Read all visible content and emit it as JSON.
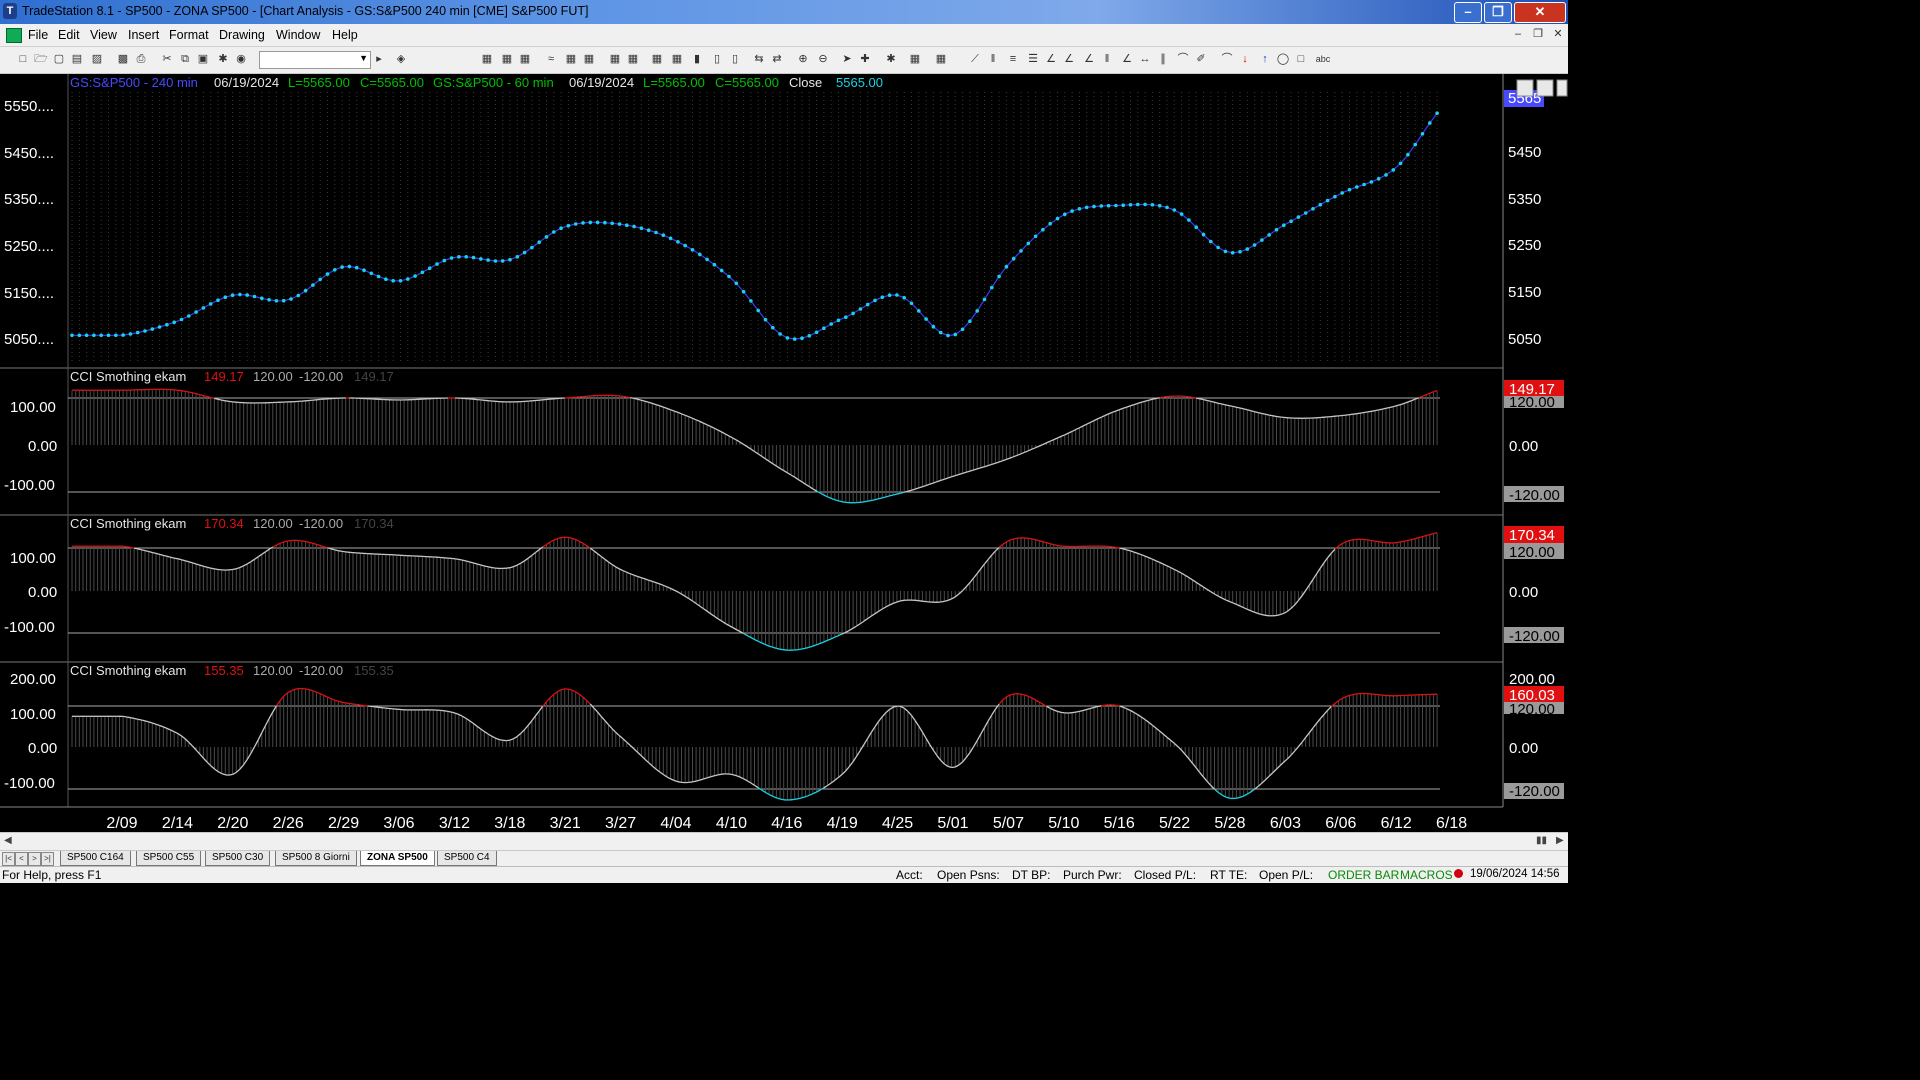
{
  "window": {
    "title": "TradeStation 8.1 - SP500 - ZONA SP500 - [Chart Analysis - GS:S&P500  240 min  [CME] S&P500 FUT]",
    "controls": [
      "minimize-icon",
      "restore-icon",
      "close-icon"
    ]
  },
  "menu": [
    "File",
    "Edit",
    "View",
    "Insert",
    "Format",
    "Drawing",
    "Window",
    "Help"
  ],
  "toolbar": {
    "symbol_combo_value": ""
  },
  "price_header": {
    "symbol1": "GS:S&P500 - 240 min",
    "date1": "06/19/2024",
    "low1": "L=5565.00",
    "close1": "C=5565.00",
    "symbol2": "GS:S&P500 - 60 min",
    "date2": "06/19/2024",
    "low2": "L=5565.00",
    "close2": "C=5565.00",
    "close_label": "Close",
    "close_value": "5565.00"
  },
  "price_axis": {
    "left_labels": [
      "5550....",
      "5450....",
      "5350....",
      "5250....",
      "5150....",
      "5050...."
    ],
    "right_labels": [
      "5450",
      "5350",
      "5250",
      "5150",
      "5050"
    ],
    "last_marker": "5565"
  },
  "cci_panels": [
    {
      "label": "CCI Smothing ekam",
      "value": "149.17",
      "upper": "120.00",
      "lower": "-120.00",
      "dim_value": "149.17",
      "left_labels": [
        "100.00",
        "0.00",
        "-100.00"
      ],
      "right_labels": [
        "149.17",
        "120.00",
        "0.00",
        "-120.00"
      ]
    },
    {
      "label": "CCI Smothing ekam",
      "value": "170.34",
      "upper": "120.00",
      "lower": "-120.00",
      "dim_value": "170.34",
      "left_labels": [
        "100.00",
        "0.00",
        "-100.00"
      ],
      "right_labels": [
        "170.34",
        "120.00",
        "0.00",
        "-120.00"
      ]
    },
    {
      "label": "CCI Smothing ekam",
      "value": "155.35",
      "upper": "120.00",
      "lower": "-120.00",
      "dim_value": "155.35",
      "left_labels": [
        "200.00",
        "100.00",
        "0.00",
        "-100.00"
      ],
      "right_labels": [
        "200.00",
        "160.03",
        "120.00",
        "0.00",
        "-120.00"
      ]
    }
  ],
  "date_axis": [
    "2/09",
    "2/14",
    "2/20",
    "2/26",
    "2/29",
    "3/06",
    "3/12",
    "3/18",
    "3/21",
    "3/27",
    "4/04",
    "4/10",
    "4/16",
    "4/19",
    "4/25",
    "5/01",
    "5/07",
    "5/10",
    "5/16",
    "5/22",
    "5/28",
    "6/03",
    "6/06",
    "6/12",
    "6/18"
  ],
  "workspace_tabs": [
    "SP500 C164",
    "SP500 C55",
    "SP500 C30",
    "SP500 8 Giorni",
    "ZONA SP500",
    "SP500 C4"
  ],
  "active_tab": "ZONA SP500",
  "status": {
    "help": "For Help, press F1",
    "acct": "Acct:",
    "open_psns": "Open Psns:",
    "dt_bp": "DT BP:",
    "purch_pwr": "Purch Pwr:",
    "closed_pl": "Closed P/L:",
    "rt_te": "RT TE:",
    "open_pl": "Open P/L:",
    "order_bar": "ORDER BAR",
    "macros": "MACROS",
    "datetime": "19/06/2024 14:56"
  },
  "colors": {
    "price_line": "#3b3bff",
    "price_dots": "#19d3e6",
    "cci_normal": "#c8c8c8",
    "cci_above": "#e01010",
    "cci_below": "#19d3e6",
    "header_green": "#00c000",
    "header_blue": "#4848ff",
    "value_red": "#e01010"
  },
  "chart_data": [
    {
      "type": "line",
      "title": "GS:S&P500 - 240 min",
      "ylim": [
        5000,
        5580
      ],
      "x": [
        "2/09",
        "2/14",
        "2/20",
        "2/26",
        "2/29",
        "3/06",
        "3/12",
        "3/18",
        "3/21",
        "3/27",
        "4/04",
        "4/10",
        "4/16",
        "4/19",
        "4/25",
        "5/01",
        "5/07",
        "5/10",
        "5/16",
        "5/22",
        "5/28",
        "6/03",
        "6/06",
        "6/12",
        "6/18"
      ],
      "series": [
        {
          "name": "GS:S&P500",
          "values": [
            5065,
            5095,
            5150,
            5140,
            5210,
            5180,
            5230,
            5225,
            5295,
            5300,
            5265,
            5185,
            5060,
            5100,
            5150,
            5065,
            5215,
            5320,
            5340,
            5330,
            5240,
            5300,
            5365,
            5420,
            5565
          ]
        }
      ]
    },
    {
      "type": "line",
      "title": "CCI Smothing ekam",
      "ylim": [
        -150,
        160
      ],
      "x": [
        "2/09",
        "2/14",
        "2/20",
        "2/26",
        "2/29",
        "3/06",
        "3/12",
        "3/18",
        "3/21",
        "3/27",
        "4/04",
        "4/10",
        "4/16",
        "4/19",
        "4/25",
        "5/01",
        "5/07",
        "5/10",
        "5/16",
        "5/22",
        "5/28",
        "6/03",
        "6/06",
        "6/12",
        "6/18"
      ],
      "series": [
        {
          "name": "CCI Smothing ekam",
          "values": [
            140,
            140,
            110,
            110,
            120,
            115,
            120,
            110,
            120,
            125,
            85,
            20,
            -70,
            -145,
            -125,
            -80,
            -35,
            25,
            90,
            125,
            100,
            70,
            75,
            100,
            149.17
          ]
        }
      ]
    },
    {
      "type": "line",
      "title": "CCI Smothing ekam",
      "ylim": [
        -200,
        200
      ],
      "x": [
        "2/09",
        "2/14",
        "2/20",
        "2/26",
        "2/29",
        "3/06",
        "3/12",
        "3/18",
        "3/21",
        "3/27",
        "4/04",
        "4/10",
        "4/16",
        "4/19",
        "4/25",
        "5/01",
        "5/07",
        "5/10",
        "5/16",
        "5/22",
        "5/28",
        "6/03",
        "6/06",
        "6/12",
        "6/18"
      ],
      "series": [
        {
          "name": "CCI Smothing ekam",
          "values": [
            125,
            90,
            60,
            140,
            110,
            100,
            90,
            65,
            150,
            60,
            0,
            -100,
            -165,
            -120,
            -30,
            -20,
            140,
            125,
            120,
            60,
            -30,
            -60,
            130,
            135,
            170.34
          ]
        }
      ]
    },
    {
      "type": "line",
      "title": "CCI Smothing ekam",
      "ylim": [
        -180,
        220
      ],
      "x": [
        "2/09",
        "2/14",
        "2/20",
        "2/26",
        "2/29",
        "3/06",
        "3/12",
        "3/18",
        "3/21",
        "3/27",
        "4/04",
        "4/10",
        "4/16",
        "4/19",
        "4/25",
        "5/01",
        "5/07",
        "5/10",
        "5/16",
        "5/22",
        "5/28",
        "6/03",
        "6/06",
        "6/12",
        "6/18"
      ],
      "series": [
        {
          "name": "CCI Smothing ekam",
          "values": [
            90,
            40,
            -80,
            160,
            130,
            110,
            100,
            20,
            170,
            30,
            -100,
            -80,
            -155,
            -80,
            120,
            -60,
            150,
            100,
            120,
            10,
            -150,
            -40,
            140,
            150,
            155.35
          ]
        }
      ]
    }
  ]
}
